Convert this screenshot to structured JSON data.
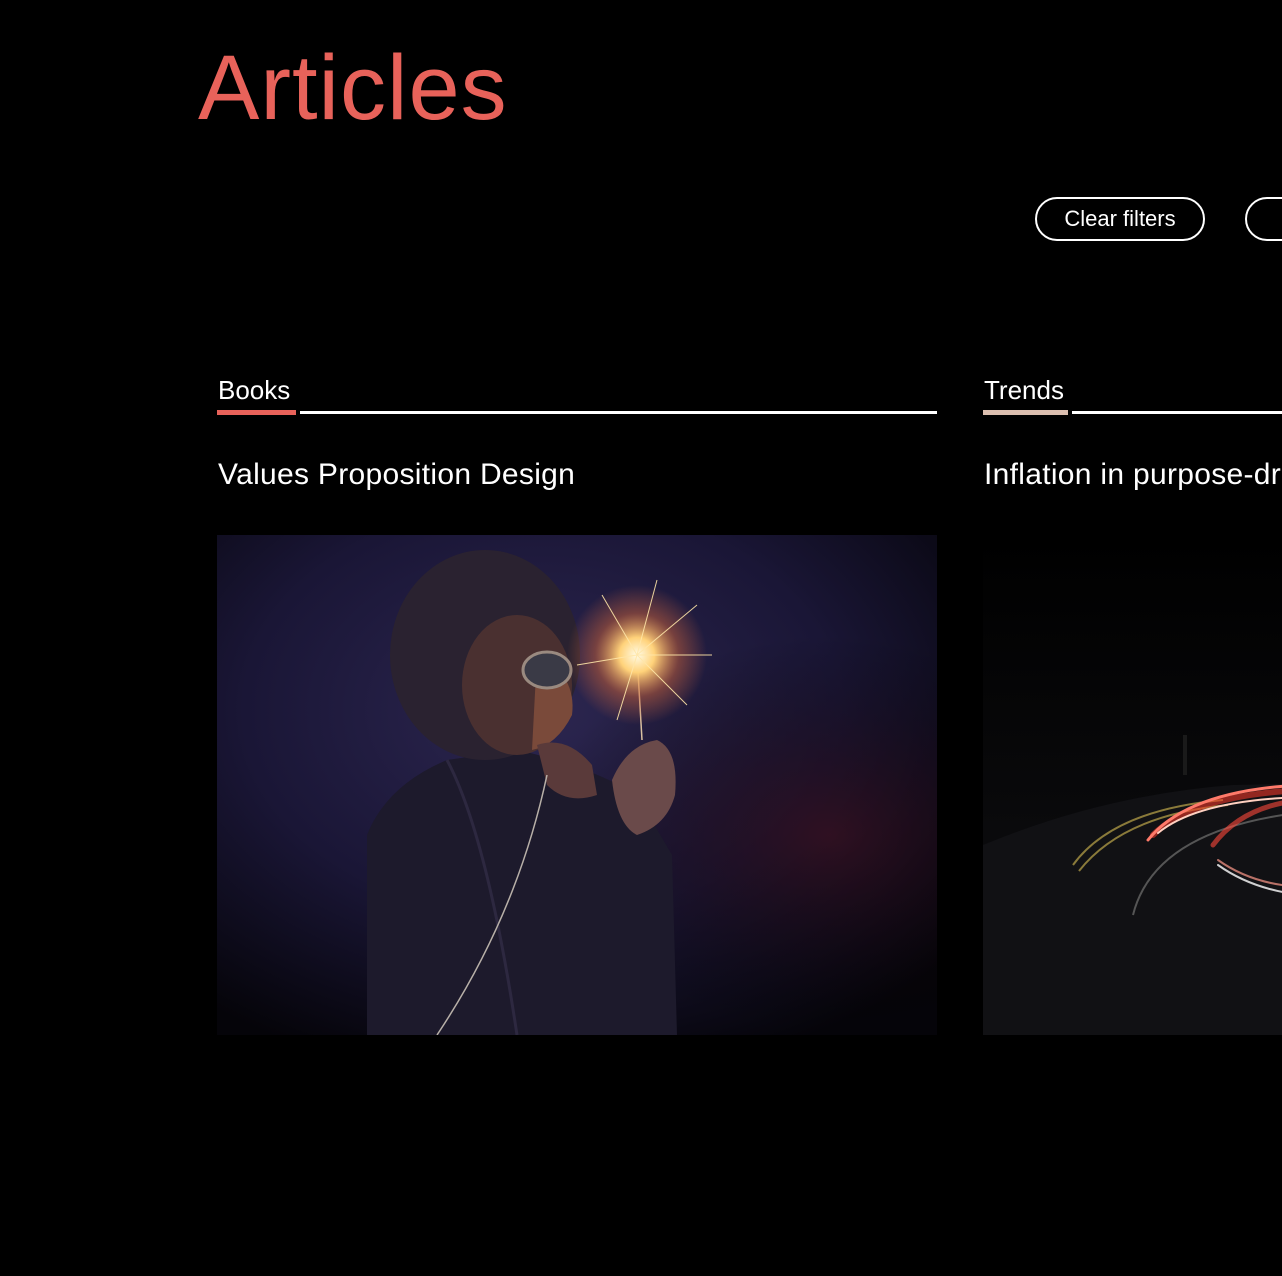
{
  "page": {
    "title": "Articles"
  },
  "filters": {
    "clear_label": "Clear filters",
    "second_label": ""
  },
  "theme": {
    "accent": "#e8625a",
    "accent_trends": "#dcbfb0",
    "background": "#000000",
    "text": "#ffffff"
  },
  "articles": [
    {
      "category": "Books",
      "title": "Values Proposition Design",
      "image_icon": "sparkler-portrait-image"
    },
    {
      "category": "Trends",
      "title": "Inflation in purpose-driven",
      "image_icon": "light-trails-road-image"
    }
  ]
}
